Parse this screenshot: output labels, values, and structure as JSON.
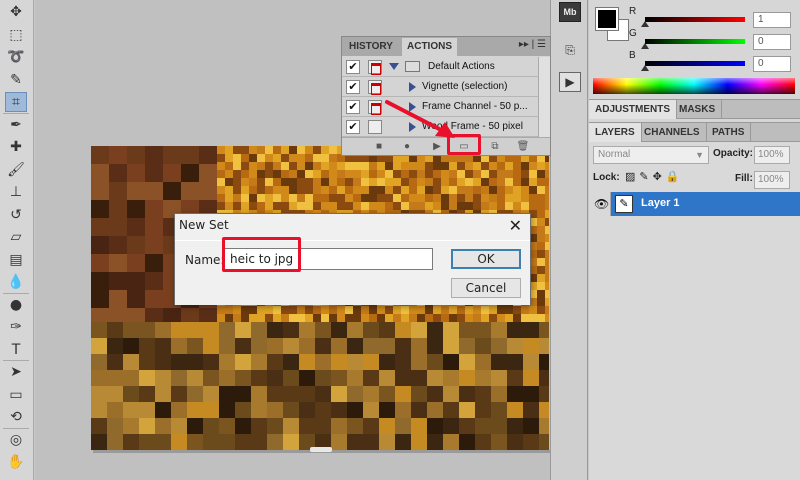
{
  "colors": {
    "accent_red": "#e8102a",
    "layer_selected": "#2f75c8",
    "panel_bg": "#d6d6d6"
  },
  "toolbox": {
    "tools": [
      {
        "name": "move-tool-icon",
        "glyph": "✥"
      },
      {
        "name": "marquee-tool-icon",
        "glyph": "⬚"
      },
      {
        "name": "lasso-tool-icon",
        "glyph": "➰"
      },
      {
        "name": "quick-select-tool-icon",
        "glyph": "✎"
      },
      {
        "name": "crop-tool-icon",
        "glyph": "⌗"
      },
      {
        "name": "eyedropper-tool-icon",
        "glyph": "✒"
      },
      {
        "name": "healing-brush-tool-icon",
        "glyph": "✚"
      },
      {
        "name": "brush-tool-icon",
        "glyph": "🖌"
      },
      {
        "name": "clone-stamp-tool-icon",
        "glyph": "⊥"
      },
      {
        "name": "history-brush-tool-icon",
        "glyph": "↺"
      },
      {
        "name": "eraser-tool-icon",
        "glyph": "▱"
      },
      {
        "name": "gradient-tool-icon",
        "glyph": "▤"
      },
      {
        "name": "blur-tool-icon",
        "glyph": "💧"
      },
      {
        "name": "dodge-tool-icon",
        "glyph": "●"
      },
      {
        "name": "pen-tool-icon",
        "glyph": "✑"
      },
      {
        "name": "type-tool-icon",
        "glyph": "T"
      },
      {
        "name": "path-select-tool-icon",
        "glyph": "➤"
      },
      {
        "name": "shape-tool-icon",
        "glyph": "▭"
      },
      {
        "name": "3d-rotate-tool-icon",
        "glyph": "⟲"
      },
      {
        "name": "3d-orbit-tool-icon",
        "glyph": "◎"
      },
      {
        "name": "hand-tool-icon",
        "glyph": "✋"
      }
    ]
  },
  "dock": {
    "mini_bridge_label": "Mb"
  },
  "color_panel": {
    "r_label": "R",
    "g_label": "G",
    "b_label": "B",
    "r_value": "1",
    "g_value": "0",
    "b_value": "0"
  },
  "adjustments_tabs": [
    "ADJUSTMENTS",
    "MASKS"
  ],
  "layers_tabs": [
    "LAYERS",
    "CHANNELS",
    "PATHS"
  ],
  "layers": {
    "blend_mode": "Normal",
    "opacity_label": "Opacity:",
    "opacity_value": "100%",
    "lock_label": "Lock:",
    "fill_label": "Fill:",
    "fill_value": "100%",
    "layer_name": "Layer 1"
  },
  "actions_panel": {
    "tab_history": "HISTORY",
    "tab_actions": "ACTIONS",
    "controls": "▸▸ | ☰",
    "rows": [
      {
        "label": "Default Actions",
        "checked": true
      },
      {
        "label": "Vignette (selection)",
        "checked": true
      },
      {
        "label": "Frame Channel - 50 p...",
        "checked": true
      },
      {
        "label": "Wood Frame - 50 pixel",
        "checked": true
      }
    ],
    "check_glyph": "✔"
  },
  "dialog": {
    "title": "New Set",
    "close_glyph": "✕",
    "name_label": "Name:",
    "name_value": "heic to jpg",
    "ok_label": "OK",
    "cancel_label": "Cancel"
  }
}
